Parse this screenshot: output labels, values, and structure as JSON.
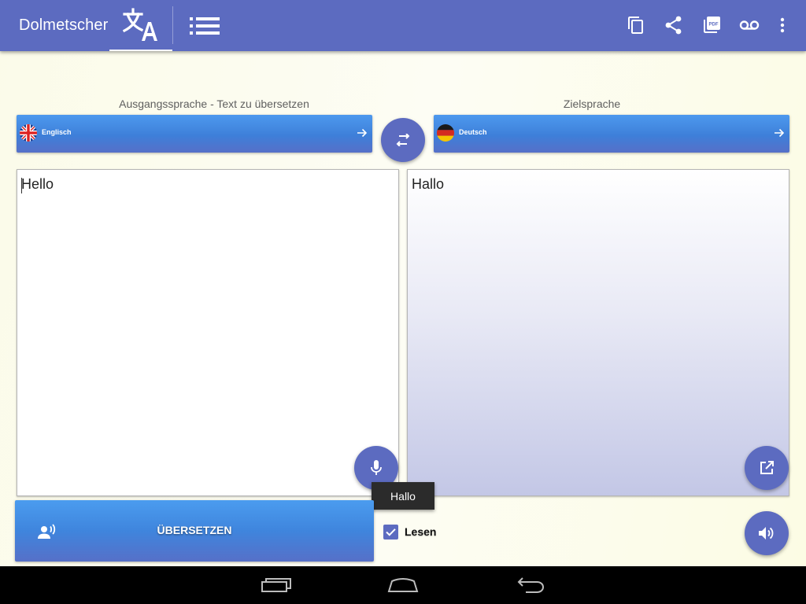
{
  "app": {
    "title": "Dolmetscher"
  },
  "tabs": [
    {
      "name": "translate",
      "icon": "translate-icon",
      "active": true
    },
    {
      "name": "list",
      "icon": "list-icon",
      "active": false
    }
  ],
  "actions": [
    "copy-icon",
    "share-icon",
    "pdf-icon",
    "voicemail-icon",
    "more-vert-icon"
  ],
  "source": {
    "caption": "Ausgangssprache - Text zu übersetzen",
    "language": "Englisch",
    "text": "Hello"
  },
  "target": {
    "caption": "Zielsprache",
    "language": "Deutsch",
    "text": "Hallo"
  },
  "tooltip": {
    "text": "Hallo"
  },
  "translate_button": {
    "label": "ÜBERSETZEN"
  },
  "read_checkbox": {
    "label": "Lesen",
    "checked": true
  },
  "colors": {
    "primary": "#5c6bc0",
    "button_blue": "#4286e0"
  }
}
